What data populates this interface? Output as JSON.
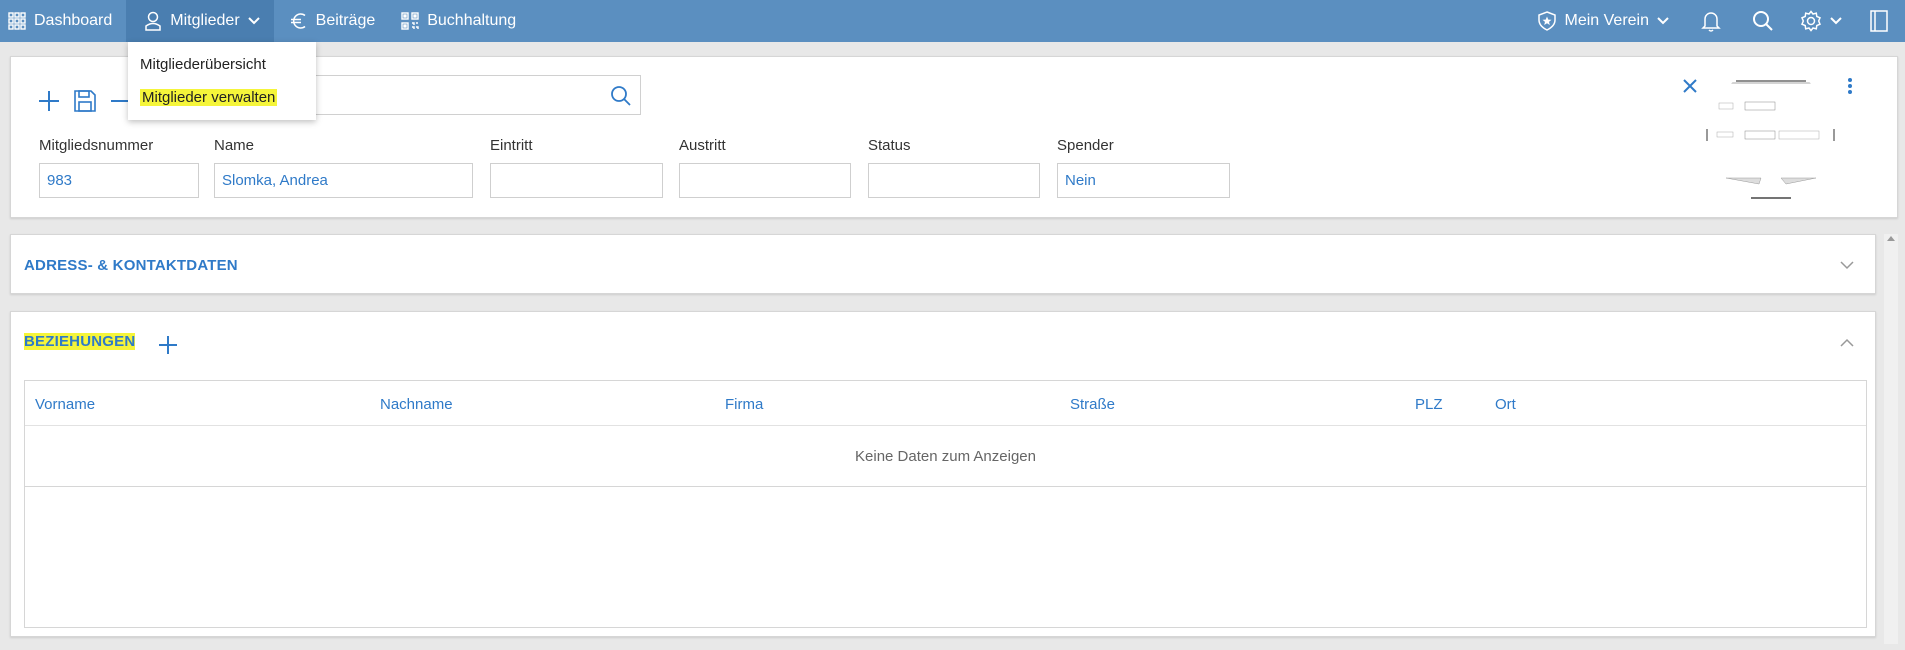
{
  "nav": {
    "dashboard": "Dashboard",
    "mitglieder": "Mitglieder",
    "beitraege": "Beiträge",
    "buchhaltung": "Buchhaltung",
    "verein": "Mein Verein"
  },
  "dropdown": {
    "items": [
      "Mitgliederübersicht",
      "Mitglieder verwalten"
    ]
  },
  "member": {
    "search_value": "",
    "fields": [
      {
        "label": "Mitgliedsnummer",
        "value": "983"
      },
      {
        "label": "Name",
        "value": "Slomka, Andrea"
      },
      {
        "label": "Eintritt",
        "value": ""
      },
      {
        "label": "Austritt",
        "value": ""
      },
      {
        "label": "Status",
        "value": ""
      },
      {
        "label": "Spender",
        "value": "Nein"
      }
    ]
  },
  "sections": {
    "address_title": "ADRESS- & KONTAKTDATEN",
    "relations_title": "BEZIEHUNGEN"
  },
  "relations_table": {
    "columns": [
      "Vorname",
      "Nachname",
      "Firma",
      "Straße",
      "PLZ",
      "Ort"
    ],
    "empty_text": "Keine Daten zum Anzeigen"
  },
  "colors": {
    "nav_bg": "#5b8fc0",
    "accent": "#2f7ac8",
    "highlight": "#f5f53a"
  },
  "icons": {
    "dashboard": "grid-icon",
    "mitglieder": "user-icon",
    "beitraege": "euro-icon",
    "buchhaltung": "qr-icon",
    "verein": "shield-star-icon",
    "notifications": "bell-icon",
    "search": "search-icon",
    "settings": "gear-icon",
    "panel": "panel-icon"
  }
}
